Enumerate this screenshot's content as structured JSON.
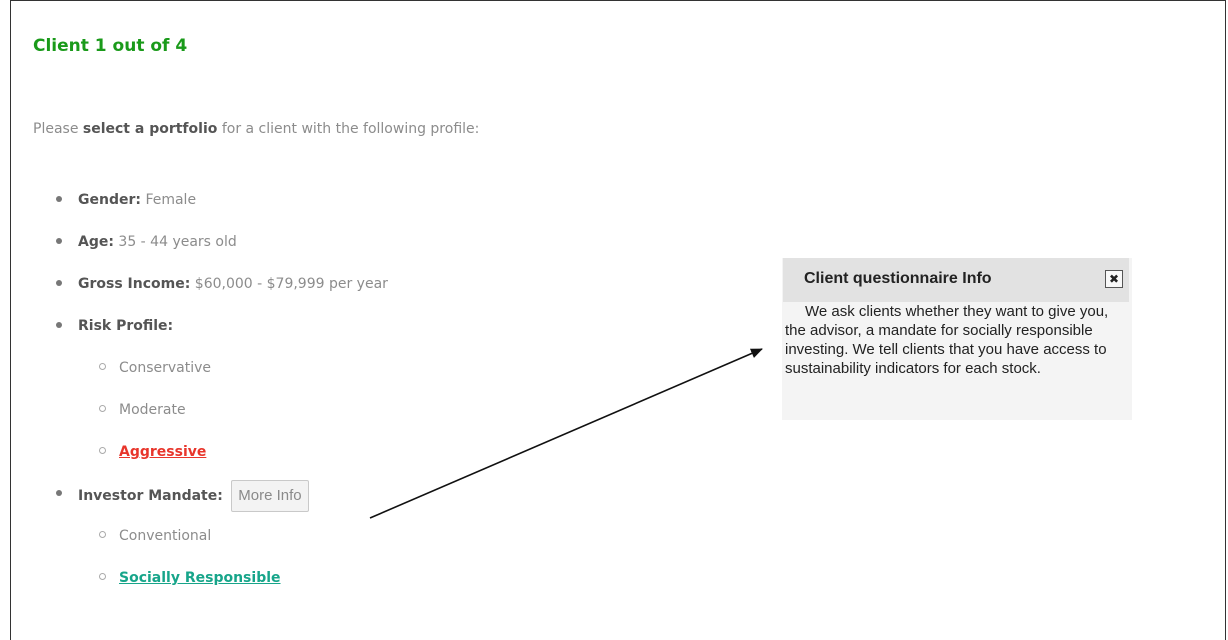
{
  "header": {
    "title": "Client 1 out of 4"
  },
  "intro": {
    "prefix": "Please ",
    "emphasis": "select a portfolio",
    "suffix": " for a client with the following profile:"
  },
  "profile": {
    "gender": {
      "label": "Gender:",
      "value": "Female"
    },
    "age": {
      "label": "Age:",
      "value": "35 - 44 years old"
    },
    "income": {
      "label": "Gross Income:",
      "value": "$60,000 - $79,999 per year"
    },
    "risk": {
      "label": "Risk Profile:",
      "options": [
        "Conservative",
        "Moderate",
        "Aggressive"
      ],
      "selected": "Aggressive"
    },
    "mandate": {
      "label": "Investor Mandate:",
      "more_info_label": "More Info",
      "options": [
        "Conventional",
        "Socially Responsible"
      ],
      "selected": "Socially Responsible"
    }
  },
  "tooltip": {
    "title": "Client questionnaire Info",
    "close_symbol": "✖",
    "body": "We ask clients whether they want to give you, the advisor, a mandate for socially responsible investing. We tell clients that you have access to sustainability indicators for each stock."
  },
  "colors": {
    "title_green": "#1a9a1a",
    "aggressive_red": "#e8352b",
    "socially_teal": "#17a58a"
  }
}
